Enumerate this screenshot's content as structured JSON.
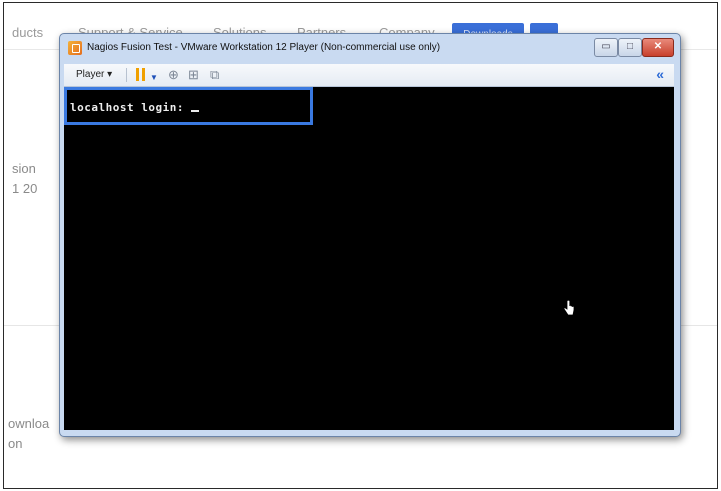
{
  "site": {
    "nav": [
      "ducts",
      "Support & Service",
      "Solutions",
      "Partners",
      "Company"
    ],
    "downloads_button": "Downloads",
    "left_text": [
      "sion",
      "1 20",
      "ownloa",
      "on"
    ]
  },
  "vmware": {
    "title": "Nagios Fusion Test - VMware Workstation 12 Player (Non-commercial use only)",
    "toolbar": {
      "player_menu": "Player ▾"
    },
    "console": {
      "prompt": "localhost login: "
    }
  },
  "colors": {
    "accent": "#3a79e0",
    "console_bg": "#000000"
  }
}
